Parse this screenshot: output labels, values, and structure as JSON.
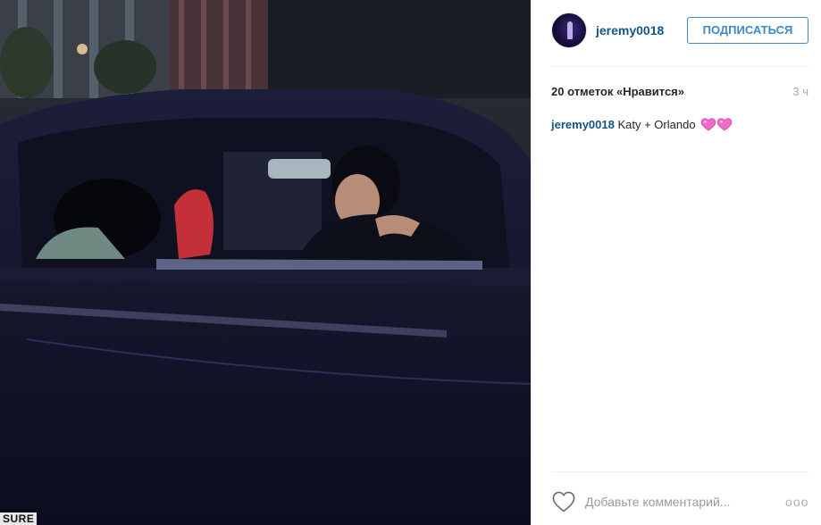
{
  "post": {
    "username": "jeremy0018",
    "follow_label": "ПОДПИСАТЬСЯ",
    "likes_text": "20 отметок «Нравится»",
    "time_ago": "3 ч",
    "caption": {
      "username": "jeremy0018",
      "text": "Katy + Orlando"
    },
    "comment_placeholder": "Добавьте комментарий...",
    "more_label": "ооо"
  },
  "photo": {
    "watermark": "SURE"
  },
  "icons": {
    "like": "heart-outline-icon",
    "caption_emoji": "two-hearts-emoji-icon",
    "more": "more-options-icon"
  },
  "colors": {
    "link": "#125688",
    "follow_border": "#3f88c5",
    "muted": "#a5a7aa",
    "emoji_pink": "#f06bc9"
  }
}
